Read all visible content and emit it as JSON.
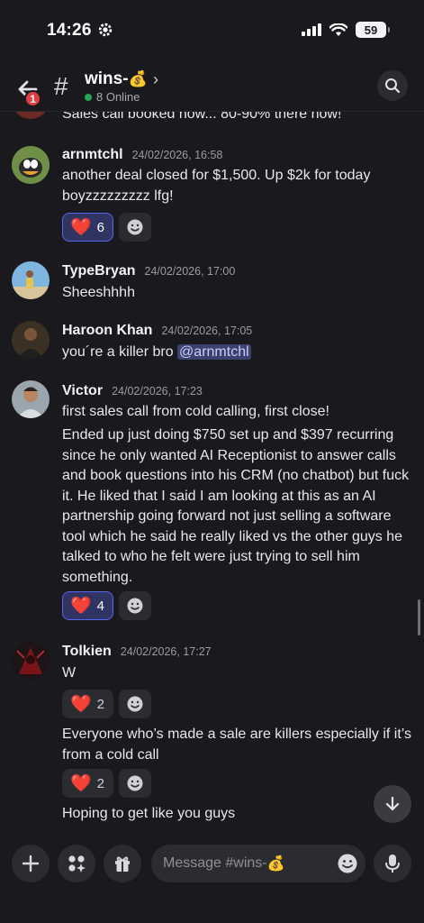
{
  "status_bar": {
    "time": "14:26",
    "battery": "59"
  },
  "header": {
    "back_badge": "1",
    "channel_name": "wins-",
    "channel_emoji": "💰",
    "online": "8 Online"
  },
  "partial_message": "Sales call booked now... 80-90% there now!",
  "messages": [
    {
      "author": "arnmtchl",
      "time": "24/02/2026, 16:58",
      "text": "another deal closed for $1,500. Up $2k for today boyzzzzzzzzz lfg!",
      "reaction": {
        "emoji": "❤️",
        "count": "6",
        "reacted": true
      }
    },
    {
      "author": "TypeBryan",
      "time": "24/02/2026, 17:00",
      "text": "Sheeshhhh"
    },
    {
      "author": "Haroon Khan",
      "time": "24/02/2026, 17:05",
      "text": "you´re a killer bro ",
      "mention": "@arnmtchl"
    },
    {
      "author": "Victor",
      "time": "24/02/2026, 17:23",
      "text": "first sales call from cold calling, first close!",
      "text2": "Ended up just doing $750 set up and $397 recurring since he only wanted AI Receptionist to answer calls and book questions into his CRM (no chatbot) but fuck it. He liked that I said I am looking at this as an AI partnership going forward not just selling a software tool which he said he really liked vs the other guys he talked to who he felt were just trying to sell him something.",
      "reaction": {
        "emoji": "❤️",
        "count": "4",
        "reacted": true
      }
    },
    {
      "author": "Tolkien",
      "time": "24/02/2026, 17:27",
      "text": "W",
      "reaction": {
        "emoji": "❤️",
        "count": "2",
        "reacted": false
      },
      "text2": "Everyone who’s made a sale are killers especially if it’s from a cold call",
      "reaction2": {
        "emoji": "❤️",
        "count": "2",
        "reacted": false
      },
      "text3": "Hoping to get like you guys"
    }
  ],
  "composer": {
    "placeholder": "Message #wins-",
    "placeholder_emoji": "💰"
  },
  "icons": {
    "back": "arrow-left-icon",
    "search": "search-icon",
    "plus": "plus-icon",
    "apps": "apps-icon",
    "gift": "gift-icon",
    "emoji": "smile-icon",
    "mic": "microphone-icon",
    "jump": "arrow-down-icon"
  },
  "colors": {
    "accent": "#5865f2",
    "online": "#23a55a",
    "badge": "#e03f45",
    "heart": "#e8333f"
  }
}
